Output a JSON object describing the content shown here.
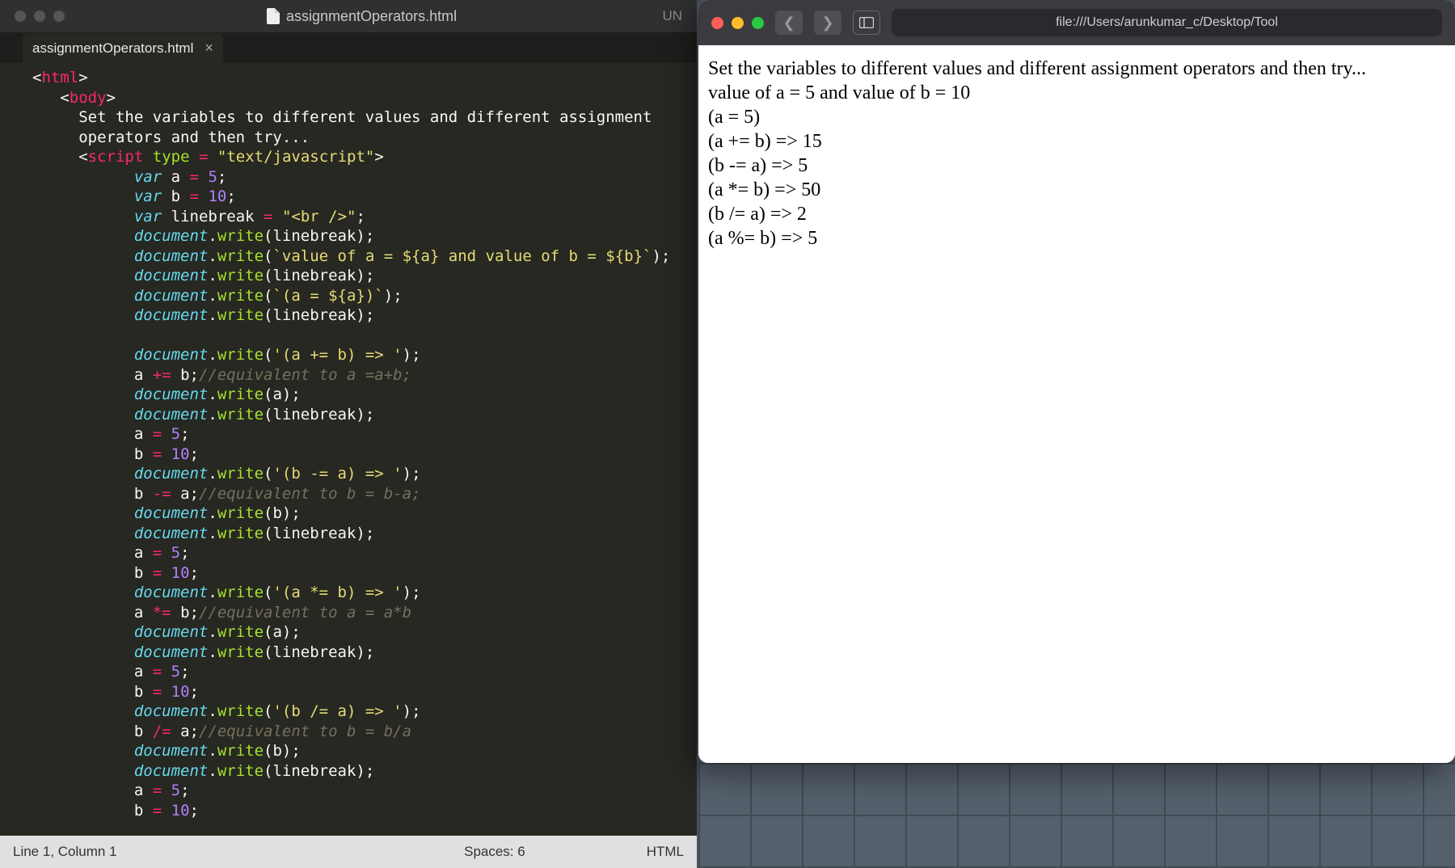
{
  "editor": {
    "title_file": "assignmentOperators.html",
    "title_right": "UN",
    "tab_label": "assignmentOperators.html",
    "status": {
      "position": "Line 1, Column 1",
      "spaces": "Spaces: 6",
      "lang": "HTML"
    },
    "code": {
      "l01_tag": "html",
      "l02_tag": "body",
      "l03": "Set the variables to different values and different assignment",
      "l04": "operators and then try...",
      "l05_tag": "script",
      "l05_attr": "type",
      "l05_val": "\"text/javascript\"",
      "l06_kw": "var",
      "l06_name": "a",
      "l06_val": "5",
      "l07_kw": "var",
      "l07_name": "b",
      "l07_val": "10",
      "l08_kw": "var",
      "l08_name": "linebreak",
      "l08_val": "\"<br />\"",
      "l09_obj": "document",
      "l09_fn": "write",
      "l09_arg": "linebreak",
      "l10_obj": "document",
      "l10_fn": "write",
      "l10_arg": "`value of a = ${a} and value of b = ${b}`",
      "l11_obj": "document",
      "l11_fn": "write",
      "l11_arg": "linebreak",
      "l12_obj": "document",
      "l12_fn": "write",
      "l12_arg": "`(a = ${a})`",
      "l13_obj": "document",
      "l13_fn": "write",
      "l13_arg": "linebreak",
      "l15_obj": "document",
      "l15_fn": "write",
      "l15_arg": "'(a += b) => '",
      "l16_stmt": "a += b;",
      "l16_cmt": "//equivalent to a =a+b;",
      "l17_obj": "document",
      "l17_fn": "write",
      "l17_arg": "a",
      "l18_obj": "document",
      "l18_fn": "write",
      "l18_arg": "linebreak",
      "l19": "a = 5;",
      "l20": "b = 10;",
      "l21_obj": "document",
      "l21_fn": "write",
      "l21_arg": "'(b -= a) => '",
      "l22_stmt": "b -= a;",
      "l22_cmt": "//equivalent to b = b-a;",
      "l23_obj": "document",
      "l23_fn": "write",
      "l23_arg": "b",
      "l24_obj": "document",
      "l24_fn": "write",
      "l24_arg": "linebreak",
      "l25": "a = 5;",
      "l26": "b = 10;",
      "l27_obj": "document",
      "l27_fn": "write",
      "l27_arg": "'(a *= b) => '",
      "l28_stmt": "a *= b;",
      "l28_cmt": "//equivalent to a = a*b",
      "l29_obj": "document",
      "l29_fn": "write",
      "l29_arg": "a",
      "l30_obj": "document",
      "l30_fn": "write",
      "l30_arg": "linebreak",
      "l31": "a = 5;",
      "l32": "b = 10;",
      "l33_obj": "document",
      "l33_fn": "write",
      "l33_arg": "'(b /= a) => '",
      "l34_stmt": "b /= a;",
      "l34_cmt": "//equivalent to b = b/a",
      "l35_obj": "document",
      "l35_fn": "write",
      "l35_arg": "b",
      "l36_obj": "document",
      "l36_fn": "write",
      "l36_arg": "linebreak",
      "l37": "a = 5;",
      "l38": "b = 10;"
    }
  },
  "browser": {
    "url": "file:///Users/arunkumar_c/Desktop/Tool",
    "lines": [
      "Set the variables to different values and different assignment operators and then try...",
      "value of a = 5 and value of b = 10",
      "(a = 5)",
      "(a += b) => 15",
      "(b -= a) => 5",
      "(a *= b) => 50",
      "(b /= a) => 2",
      "(a %= b) => 5"
    ]
  }
}
